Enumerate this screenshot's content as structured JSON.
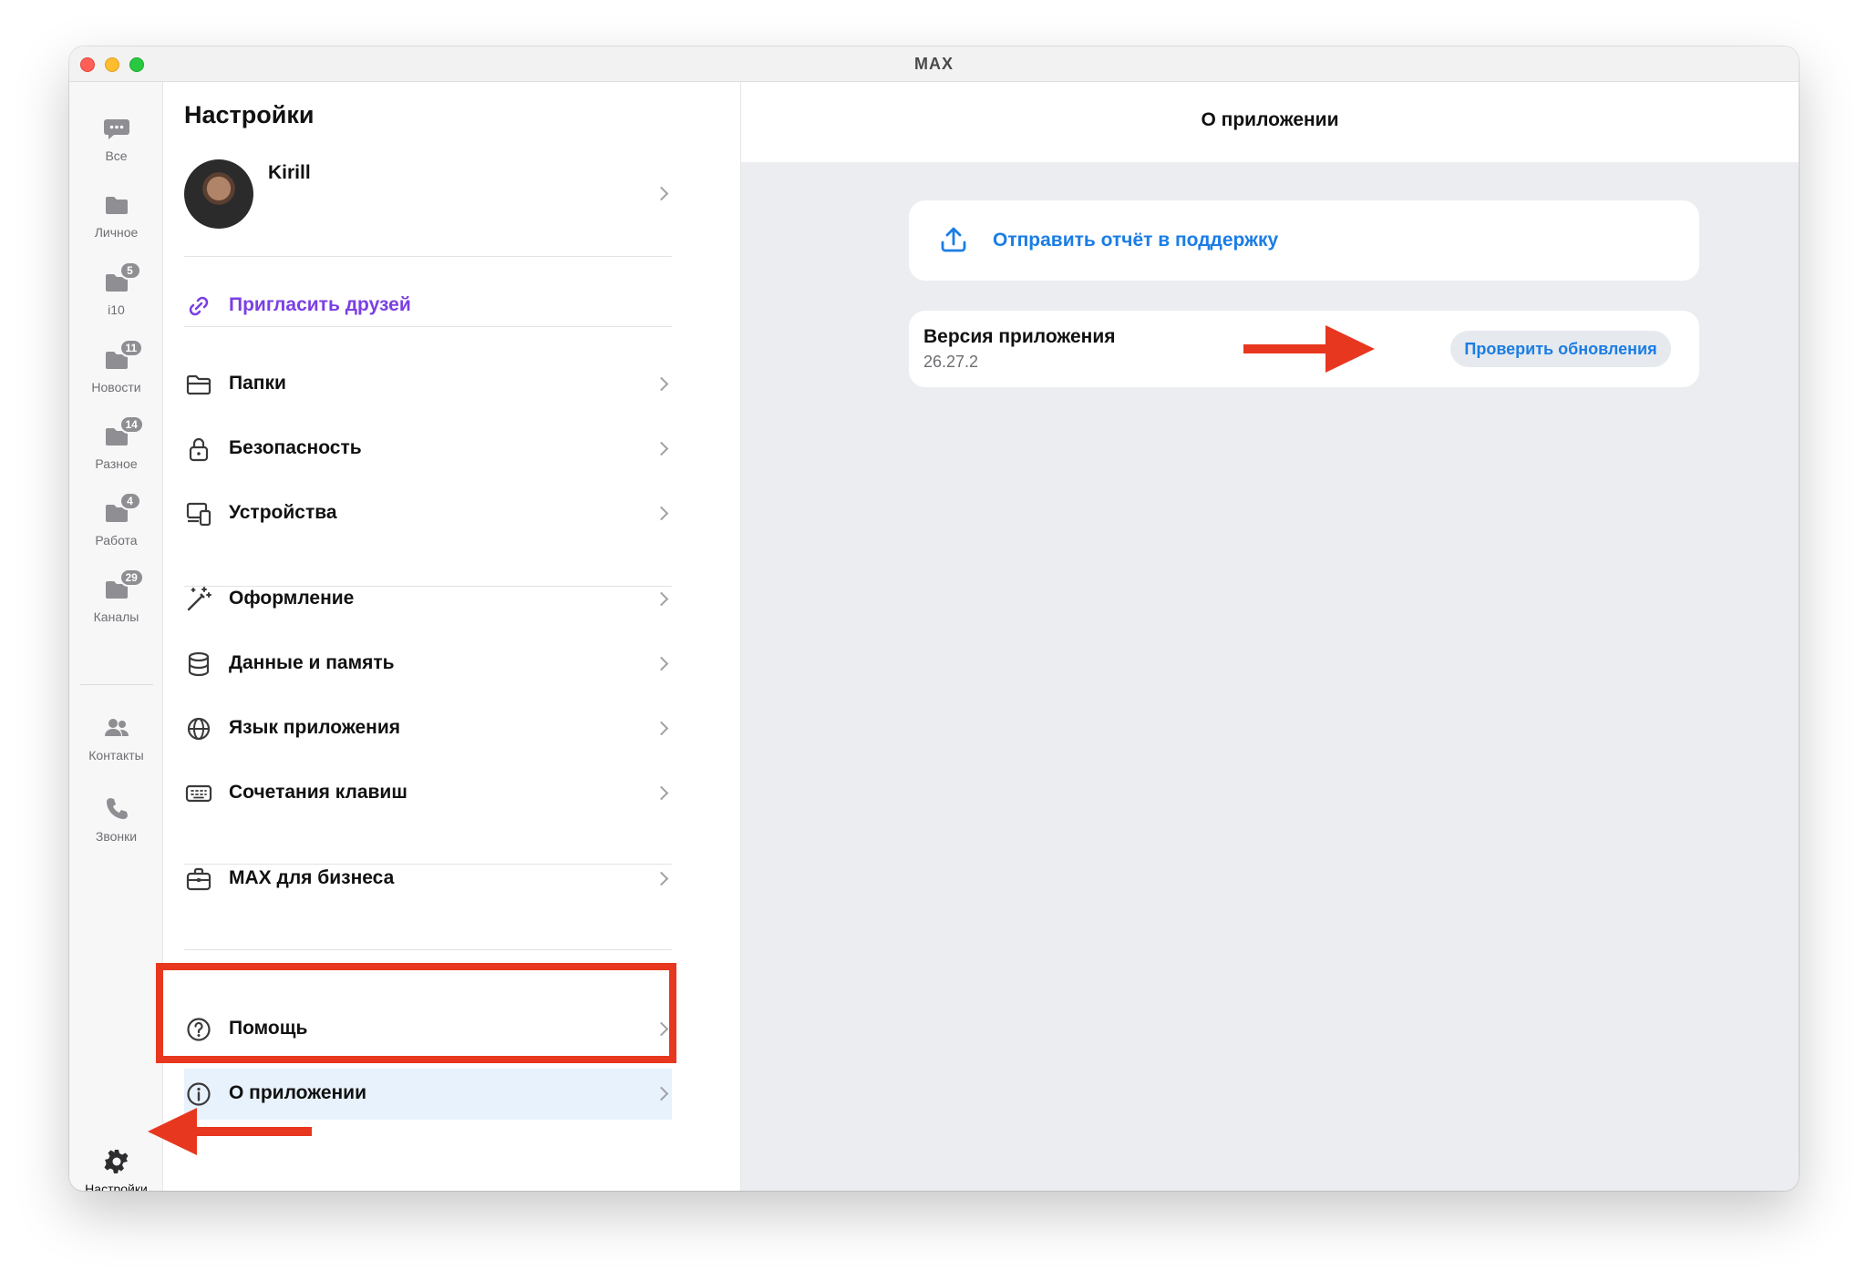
{
  "window": {
    "title": "MAX"
  },
  "rail": {
    "items": [
      {
        "label": "Все",
        "icon": "chat-bubble-icon",
        "badge": ""
      },
      {
        "label": "Личное",
        "icon": "folder-icon",
        "badge": ""
      },
      {
        "label": "i10",
        "icon": "folder-icon",
        "badge": "5"
      },
      {
        "label": "Новости",
        "icon": "folder-icon",
        "badge": "11"
      },
      {
        "label": "Разное",
        "icon": "folder-icon",
        "badge": "14"
      },
      {
        "label": "Работа",
        "icon": "folder-icon",
        "badge": "4"
      },
      {
        "label": "Каналы",
        "icon": "folder-icon",
        "badge": "29"
      },
      {
        "label": "Контакты",
        "icon": "contacts-icon",
        "badge": ""
      },
      {
        "label": "Звонки",
        "icon": "phone-icon",
        "badge": ""
      }
    ],
    "settings_label": "Настройки"
  },
  "settings": {
    "title": "Настройки",
    "profile_name": "Kirill",
    "invite": "Пригласить друзей",
    "items": [
      "Папки",
      "Безопасность",
      "Устройства",
      "Оформление",
      "Данные и память",
      "Язык приложения",
      "Сочетания клавиш",
      "MAX для бизнеса",
      "Помощь",
      "О приложении"
    ]
  },
  "about": {
    "title": "О приложении",
    "report": "Отправить отчёт в поддержку",
    "version_title": "Версия приложения",
    "version_number": "26.27.2",
    "check_updates": "Проверить обновления"
  },
  "colors": {
    "accent_blue": "#1b7de4",
    "invite_purple": "#7b3fe4",
    "annotation_red": "#e8371f",
    "active_row": "#e8f2fd"
  }
}
